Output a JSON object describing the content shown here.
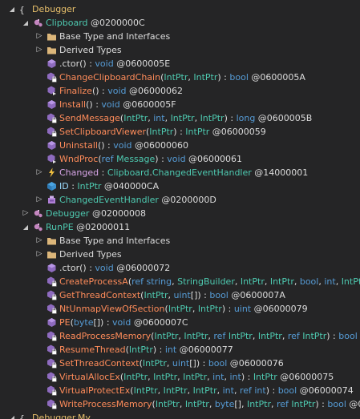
{
  "rows": [
    {
      "id": "r0",
      "depth": 0,
      "expanded": true,
      "icon": "namespace-icon",
      "segments": [
        {
          "t": "Debugger",
          "c": "t-ns"
        }
      ]
    },
    {
      "id": "r1",
      "depth": 1,
      "expanded": true,
      "icon": "class-icon",
      "segments": [
        {
          "t": "Clipboard",
          "c": "t-type"
        },
        {
          "t": " @0200000C",
          "c": "t-token"
        }
      ]
    },
    {
      "id": "r2",
      "depth": 2,
      "expanded": false,
      "icon": "folder-icon",
      "segments": [
        {
          "t": "Base Type and Interfaces",
          "c": "t-plain"
        }
      ]
    },
    {
      "id": "r3",
      "depth": 2,
      "expanded": false,
      "icon": "folder-icon",
      "segments": [
        {
          "t": "Derived Types",
          "c": "t-plain"
        }
      ]
    },
    {
      "id": "r4",
      "depth": 2,
      "icon": "method-public-icon",
      "segments": [
        {
          "t": ".ctor",
          "c": "t-member"
        },
        {
          "t": "() : ",
          "c": "t-plain"
        },
        {
          "t": "void",
          "c": "t-kw"
        },
        {
          "t": " @0600005E",
          "c": "t-token"
        }
      ]
    },
    {
      "id": "r5",
      "depth": 2,
      "icon": "method-private-icon",
      "segments": [
        {
          "t": "ChangeClipboardChain",
          "c": "t-method"
        },
        {
          "t": "(",
          "c": "t-plain"
        },
        {
          "t": "IntPtr",
          "c": "t-param"
        },
        {
          "t": ", ",
          "c": "t-plain"
        },
        {
          "t": "IntPtr",
          "c": "t-param"
        },
        {
          "t": ") : ",
          "c": "t-plain"
        },
        {
          "t": "bool",
          "c": "t-kw"
        },
        {
          "t": " @0600005A",
          "c": "t-token"
        }
      ]
    },
    {
      "id": "r6",
      "depth": 2,
      "icon": "method-override-icon",
      "segments": [
        {
          "t": "Finalize",
          "c": "t-method"
        },
        {
          "t": "() : ",
          "c": "t-plain"
        },
        {
          "t": "void",
          "c": "t-kw"
        },
        {
          "t": " @06000062",
          "c": "t-token"
        }
      ]
    },
    {
      "id": "r7",
      "depth": 2,
      "icon": "method-public-icon",
      "segments": [
        {
          "t": "Install",
          "c": "t-method"
        },
        {
          "t": "() : ",
          "c": "t-plain"
        },
        {
          "t": "void",
          "c": "t-kw"
        },
        {
          "t": " @0600005F",
          "c": "t-token"
        }
      ]
    },
    {
      "id": "r8",
      "depth": 2,
      "icon": "method-private-icon",
      "segments": [
        {
          "t": "SendMessage",
          "c": "t-method"
        },
        {
          "t": "(",
          "c": "t-plain"
        },
        {
          "t": "IntPtr",
          "c": "t-param"
        },
        {
          "t": ", ",
          "c": "t-plain"
        },
        {
          "t": "int",
          "c": "t-kw"
        },
        {
          "t": ", ",
          "c": "t-plain"
        },
        {
          "t": "IntPtr",
          "c": "t-param"
        },
        {
          "t": ", ",
          "c": "t-plain"
        },
        {
          "t": "IntPtr",
          "c": "t-param"
        },
        {
          "t": ") : ",
          "c": "t-plain"
        },
        {
          "t": "long",
          "c": "t-kw"
        },
        {
          "t": " @0600005B",
          "c": "t-token"
        }
      ]
    },
    {
      "id": "r9",
      "depth": 2,
      "icon": "method-private-icon",
      "segments": [
        {
          "t": "SetClipboardViewer",
          "c": "t-method"
        },
        {
          "t": "(",
          "c": "t-plain"
        },
        {
          "t": "IntPtr",
          "c": "t-param"
        },
        {
          "t": ") : ",
          "c": "t-plain"
        },
        {
          "t": "IntPtr",
          "c": "t-param"
        },
        {
          "t": " @06000059",
          "c": "t-token"
        }
      ]
    },
    {
      "id": "r10",
      "depth": 2,
      "icon": "method-public-icon",
      "segments": [
        {
          "t": "Uninstall",
          "c": "t-method"
        },
        {
          "t": "() : ",
          "c": "t-plain"
        },
        {
          "t": "void",
          "c": "t-kw"
        },
        {
          "t": " @06000060",
          "c": "t-token"
        }
      ]
    },
    {
      "id": "r11",
      "depth": 2,
      "icon": "method-override-icon",
      "segments": [
        {
          "t": "WndProc",
          "c": "t-method"
        },
        {
          "t": "(",
          "c": "t-plain"
        },
        {
          "t": "ref",
          "c": "t-kw"
        },
        {
          "t": " ",
          "c": "t-plain"
        },
        {
          "t": "Message",
          "c": "t-param"
        },
        {
          "t": ") : ",
          "c": "t-plain"
        },
        {
          "t": "void",
          "c": "t-kw"
        },
        {
          "t": " @06000061",
          "c": "t-token"
        }
      ]
    },
    {
      "id": "r12",
      "depth": 2,
      "expanded": false,
      "icon": "event-icon",
      "segments": [
        {
          "t": "Changed",
          "c": "t-event"
        },
        {
          "t": " : ",
          "c": "t-plain"
        },
        {
          "t": "Clipboard",
          "c": "t-type"
        },
        {
          "t": ".",
          "c": "t-plain"
        },
        {
          "t": "ChangedEventHandler",
          "c": "t-type"
        },
        {
          "t": " @14000001",
          "c": "t-token"
        }
      ]
    },
    {
      "id": "r13",
      "depth": 2,
      "icon": "field-icon",
      "segments": [
        {
          "t": "ID",
          "c": "t-field"
        },
        {
          "t": " : ",
          "c": "t-plain"
        },
        {
          "t": "IntPtr",
          "c": "t-param"
        },
        {
          "t": " @040000CA",
          "c": "t-token"
        }
      ]
    },
    {
      "id": "r14",
      "depth": 2,
      "expanded": false,
      "icon": "delegate-icon",
      "segments": [
        {
          "t": "ChangedEventHandler",
          "c": "t-type"
        },
        {
          "t": " @0200000D",
          "c": "t-token"
        }
      ]
    },
    {
      "id": "r15",
      "depth": 1,
      "expanded": false,
      "icon": "class-icon",
      "segments": [
        {
          "t": "Debugger",
          "c": "t-type"
        },
        {
          "t": " @02000008",
          "c": "t-token"
        }
      ]
    },
    {
      "id": "r16",
      "depth": 1,
      "expanded": true,
      "icon": "class-icon",
      "segments": [
        {
          "t": "RunPE",
          "c": "t-type"
        },
        {
          "t": " @02000011",
          "c": "t-token"
        }
      ]
    },
    {
      "id": "r17",
      "depth": 2,
      "expanded": false,
      "icon": "folder-icon",
      "segments": [
        {
          "t": "Base Type and Interfaces",
          "c": "t-plain"
        }
      ]
    },
    {
      "id": "r18",
      "depth": 2,
      "expanded": false,
      "icon": "folder-icon",
      "segments": [
        {
          "t": "Derived Types",
          "c": "t-plain"
        }
      ]
    },
    {
      "id": "r19",
      "depth": 2,
      "icon": "method-public-icon",
      "segments": [
        {
          "t": ".ctor",
          "c": "t-member"
        },
        {
          "t": "() : ",
          "c": "t-plain"
        },
        {
          "t": "void",
          "c": "t-kw"
        },
        {
          "t": " @06000072",
          "c": "t-token"
        }
      ]
    },
    {
      "id": "r20",
      "depth": 2,
      "icon": "method-private-icon",
      "segments": [
        {
          "t": "CreateProcessA",
          "c": "t-method"
        },
        {
          "t": "(",
          "c": "t-plain"
        },
        {
          "t": "ref string",
          "c": "t-kw"
        },
        {
          "t": ", ",
          "c": "t-plain"
        },
        {
          "t": "StringBuilder",
          "c": "t-param"
        },
        {
          "t": ", ",
          "c": "t-plain"
        },
        {
          "t": "IntPtr",
          "c": "t-param"
        },
        {
          "t": ", ",
          "c": "t-plain"
        },
        {
          "t": "IntPtr",
          "c": "t-param"
        },
        {
          "t": ", ",
          "c": "t-plain"
        },
        {
          "t": "bool",
          "c": "t-kw"
        },
        {
          "t": ", ",
          "c": "t-plain"
        },
        {
          "t": "int",
          "c": "t-kw"
        },
        {
          "t": ", ",
          "c": "t-plain"
        },
        {
          "t": "IntPt",
          "c": "t-param"
        }
      ]
    },
    {
      "id": "r21",
      "depth": 2,
      "icon": "method-private-icon",
      "segments": [
        {
          "t": "GetThreadContext",
          "c": "t-method"
        },
        {
          "t": "(",
          "c": "t-plain"
        },
        {
          "t": "IntPtr",
          "c": "t-param"
        },
        {
          "t": ", ",
          "c": "t-plain"
        },
        {
          "t": "uint",
          "c": "t-kw"
        },
        {
          "t": "[]) : ",
          "c": "t-plain"
        },
        {
          "t": "bool",
          "c": "t-kw"
        },
        {
          "t": " @0600007A",
          "c": "t-token"
        }
      ]
    },
    {
      "id": "r22",
      "depth": 2,
      "icon": "method-private-icon",
      "segments": [
        {
          "t": "NtUnmapViewOfSection",
          "c": "t-method"
        },
        {
          "t": "(",
          "c": "t-plain"
        },
        {
          "t": "IntPtr",
          "c": "t-param"
        },
        {
          "t": ", ",
          "c": "t-plain"
        },
        {
          "t": "IntPtr",
          "c": "t-param"
        },
        {
          "t": ") : ",
          "c": "t-plain"
        },
        {
          "t": "uint",
          "c": "t-kw"
        },
        {
          "t": " @06000079",
          "c": "t-token"
        }
      ]
    },
    {
      "id": "r23",
      "depth": 2,
      "icon": "method-public-icon",
      "segments": [
        {
          "t": "PE",
          "c": "t-method"
        },
        {
          "t": "(",
          "c": "t-plain"
        },
        {
          "t": "byte",
          "c": "t-kw"
        },
        {
          "t": "[]) : ",
          "c": "t-plain"
        },
        {
          "t": "void",
          "c": "t-kw"
        },
        {
          "t": " @0600007C",
          "c": "t-token"
        }
      ]
    },
    {
      "id": "r24",
      "depth": 2,
      "icon": "method-private-icon",
      "segments": [
        {
          "t": "ReadProcessMemory",
          "c": "t-method"
        },
        {
          "t": "(",
          "c": "t-plain"
        },
        {
          "t": "IntPtr",
          "c": "t-param"
        },
        {
          "t": ", ",
          "c": "t-plain"
        },
        {
          "t": "IntPtr",
          "c": "t-param"
        },
        {
          "t": ", ",
          "c": "t-plain"
        },
        {
          "t": "ref",
          "c": "t-kw"
        },
        {
          "t": " ",
          "c": "t-plain"
        },
        {
          "t": "IntPtr",
          "c": "t-param"
        },
        {
          "t": ", ",
          "c": "t-plain"
        },
        {
          "t": "IntPtr",
          "c": "t-param"
        },
        {
          "t": ", ",
          "c": "t-plain"
        },
        {
          "t": "ref",
          "c": "t-kw"
        },
        {
          "t": " ",
          "c": "t-plain"
        },
        {
          "t": "IntPtr",
          "c": "t-param"
        },
        {
          "t": ") : ",
          "c": "t-plain"
        },
        {
          "t": "bool",
          "c": "t-kw"
        }
      ]
    },
    {
      "id": "r25",
      "depth": 2,
      "icon": "method-private-icon",
      "segments": [
        {
          "t": "ResumeThread",
          "c": "t-method"
        },
        {
          "t": "(",
          "c": "t-plain"
        },
        {
          "t": "IntPtr",
          "c": "t-param"
        },
        {
          "t": ") : ",
          "c": "t-plain"
        },
        {
          "t": "int",
          "c": "t-kw"
        },
        {
          "t": " @06000077",
          "c": "t-token"
        }
      ]
    },
    {
      "id": "r26",
      "depth": 2,
      "icon": "method-private-icon",
      "segments": [
        {
          "t": "SetThreadContext",
          "c": "t-method"
        },
        {
          "t": "(",
          "c": "t-plain"
        },
        {
          "t": "IntPtr",
          "c": "t-param"
        },
        {
          "t": ", ",
          "c": "t-plain"
        },
        {
          "t": "uint",
          "c": "t-kw"
        },
        {
          "t": "[]) : ",
          "c": "t-plain"
        },
        {
          "t": "bool",
          "c": "t-kw"
        },
        {
          "t": " @06000076",
          "c": "t-token"
        }
      ]
    },
    {
      "id": "r27",
      "depth": 2,
      "icon": "method-private-icon",
      "segments": [
        {
          "t": "VirtualAllocEx",
          "c": "t-method"
        },
        {
          "t": "(",
          "c": "t-plain"
        },
        {
          "t": "IntPtr",
          "c": "t-param"
        },
        {
          "t": ", ",
          "c": "t-plain"
        },
        {
          "t": "IntPtr",
          "c": "t-param"
        },
        {
          "t": ", ",
          "c": "t-plain"
        },
        {
          "t": "IntPtr",
          "c": "t-param"
        },
        {
          "t": ", ",
          "c": "t-plain"
        },
        {
          "t": "int",
          "c": "t-kw"
        },
        {
          "t": ", ",
          "c": "t-plain"
        },
        {
          "t": "int",
          "c": "t-kw"
        },
        {
          "t": ") : ",
          "c": "t-plain"
        },
        {
          "t": "IntPtr",
          "c": "t-param"
        },
        {
          "t": " @06000075",
          "c": "t-token"
        }
      ]
    },
    {
      "id": "r28",
      "depth": 2,
      "icon": "method-private-icon",
      "segments": [
        {
          "t": "VirtualProtectEx",
          "c": "t-method"
        },
        {
          "t": "(",
          "c": "t-plain"
        },
        {
          "t": "IntPtr",
          "c": "t-param"
        },
        {
          "t": ", ",
          "c": "t-plain"
        },
        {
          "t": "IntPtr",
          "c": "t-param"
        },
        {
          "t": ", ",
          "c": "t-plain"
        },
        {
          "t": "IntPtr",
          "c": "t-param"
        },
        {
          "t": ", ",
          "c": "t-plain"
        },
        {
          "t": "int",
          "c": "t-kw"
        },
        {
          "t": ", ",
          "c": "t-plain"
        },
        {
          "t": "ref int",
          "c": "t-kw"
        },
        {
          "t": ") : ",
          "c": "t-plain"
        },
        {
          "t": "bool",
          "c": "t-kw"
        },
        {
          "t": " @06000074",
          "c": "t-token"
        }
      ]
    },
    {
      "id": "r29",
      "depth": 2,
      "icon": "method-private-icon",
      "segments": [
        {
          "t": "WriteProcessMemory",
          "c": "t-method"
        },
        {
          "t": "(",
          "c": "t-plain"
        },
        {
          "t": "IntPtr",
          "c": "t-param"
        },
        {
          "t": ", ",
          "c": "t-plain"
        },
        {
          "t": "IntPtr",
          "c": "t-param"
        },
        {
          "t": ", ",
          "c": "t-plain"
        },
        {
          "t": "byte",
          "c": "t-kw"
        },
        {
          "t": "[], ",
          "c": "t-plain"
        },
        {
          "t": "IntPtr",
          "c": "t-param"
        },
        {
          "t": ", ",
          "c": "t-plain"
        },
        {
          "t": "ref",
          "c": "t-kw"
        },
        {
          "t": " ",
          "c": "t-plain"
        },
        {
          "t": "IntPtr",
          "c": "t-param"
        },
        {
          "t": ") : ",
          "c": "t-plain"
        },
        {
          "t": "bool",
          "c": "t-kw"
        },
        {
          "t": " @0",
          "c": "t-token"
        }
      ]
    },
    {
      "id": "r30",
      "depth": 0,
      "expanded": true,
      "icon": "namespace-icon",
      "segments": [
        {
          "t": "Debugger.My",
          "c": "t-ns"
        }
      ]
    }
  ],
  "colors": {
    "namespace": "#e8c06b",
    "class": "#4ec9b0",
    "method": "#ff8c5a",
    "keyword": "#569cd6",
    "event": "#d7a5e6",
    "background": "#252526"
  }
}
